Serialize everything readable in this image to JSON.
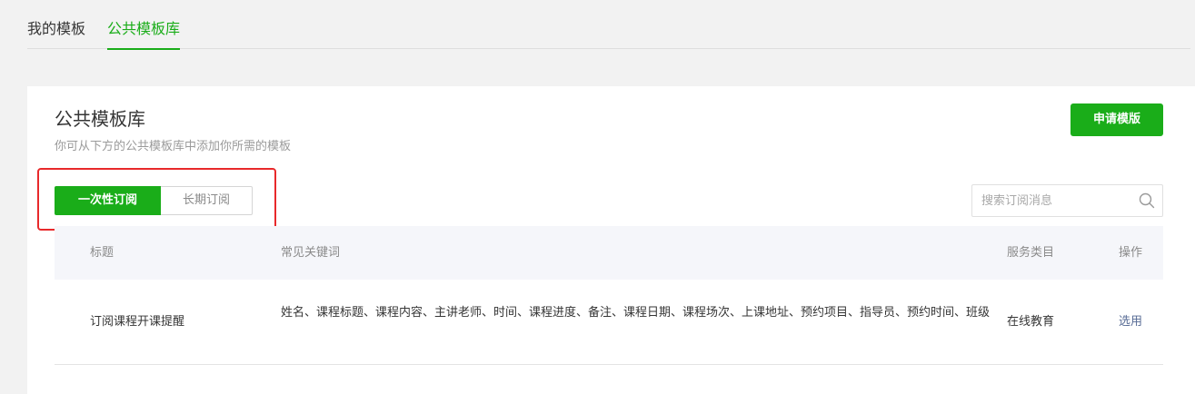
{
  "top_tabs": {
    "mine": "我的模板",
    "public": "公共模板库"
  },
  "card": {
    "title": "公共模板库",
    "description": "你可从下方的公共模板库中添加你所需的模板",
    "apply_button": "申请模版"
  },
  "subscription_types": {
    "one_time": "一次性订阅",
    "long_term": "长期订阅",
    "selected": "一次性订阅"
  },
  "search": {
    "placeholder": "搜索订阅消息",
    "value": "",
    "icon": "search-icon"
  },
  "table": {
    "columns": {
      "title": "标题",
      "keywords": "常见关键词",
      "category": "服务类目",
      "action": "操作"
    },
    "rows": [
      {
        "title": "订阅课程开课提醒",
        "keywords": "姓名、课程标题、课程内容、主讲老师、时间、课程进度、备注、课程日期、课程场次、上课地址、预约项目、指导员、预约时间、班级",
        "category": "在线教育",
        "action": "选用"
      }
    ]
  },
  "colors": {
    "accent": "#1aad19",
    "link": "#576b95",
    "highlight": "#e8292b"
  }
}
